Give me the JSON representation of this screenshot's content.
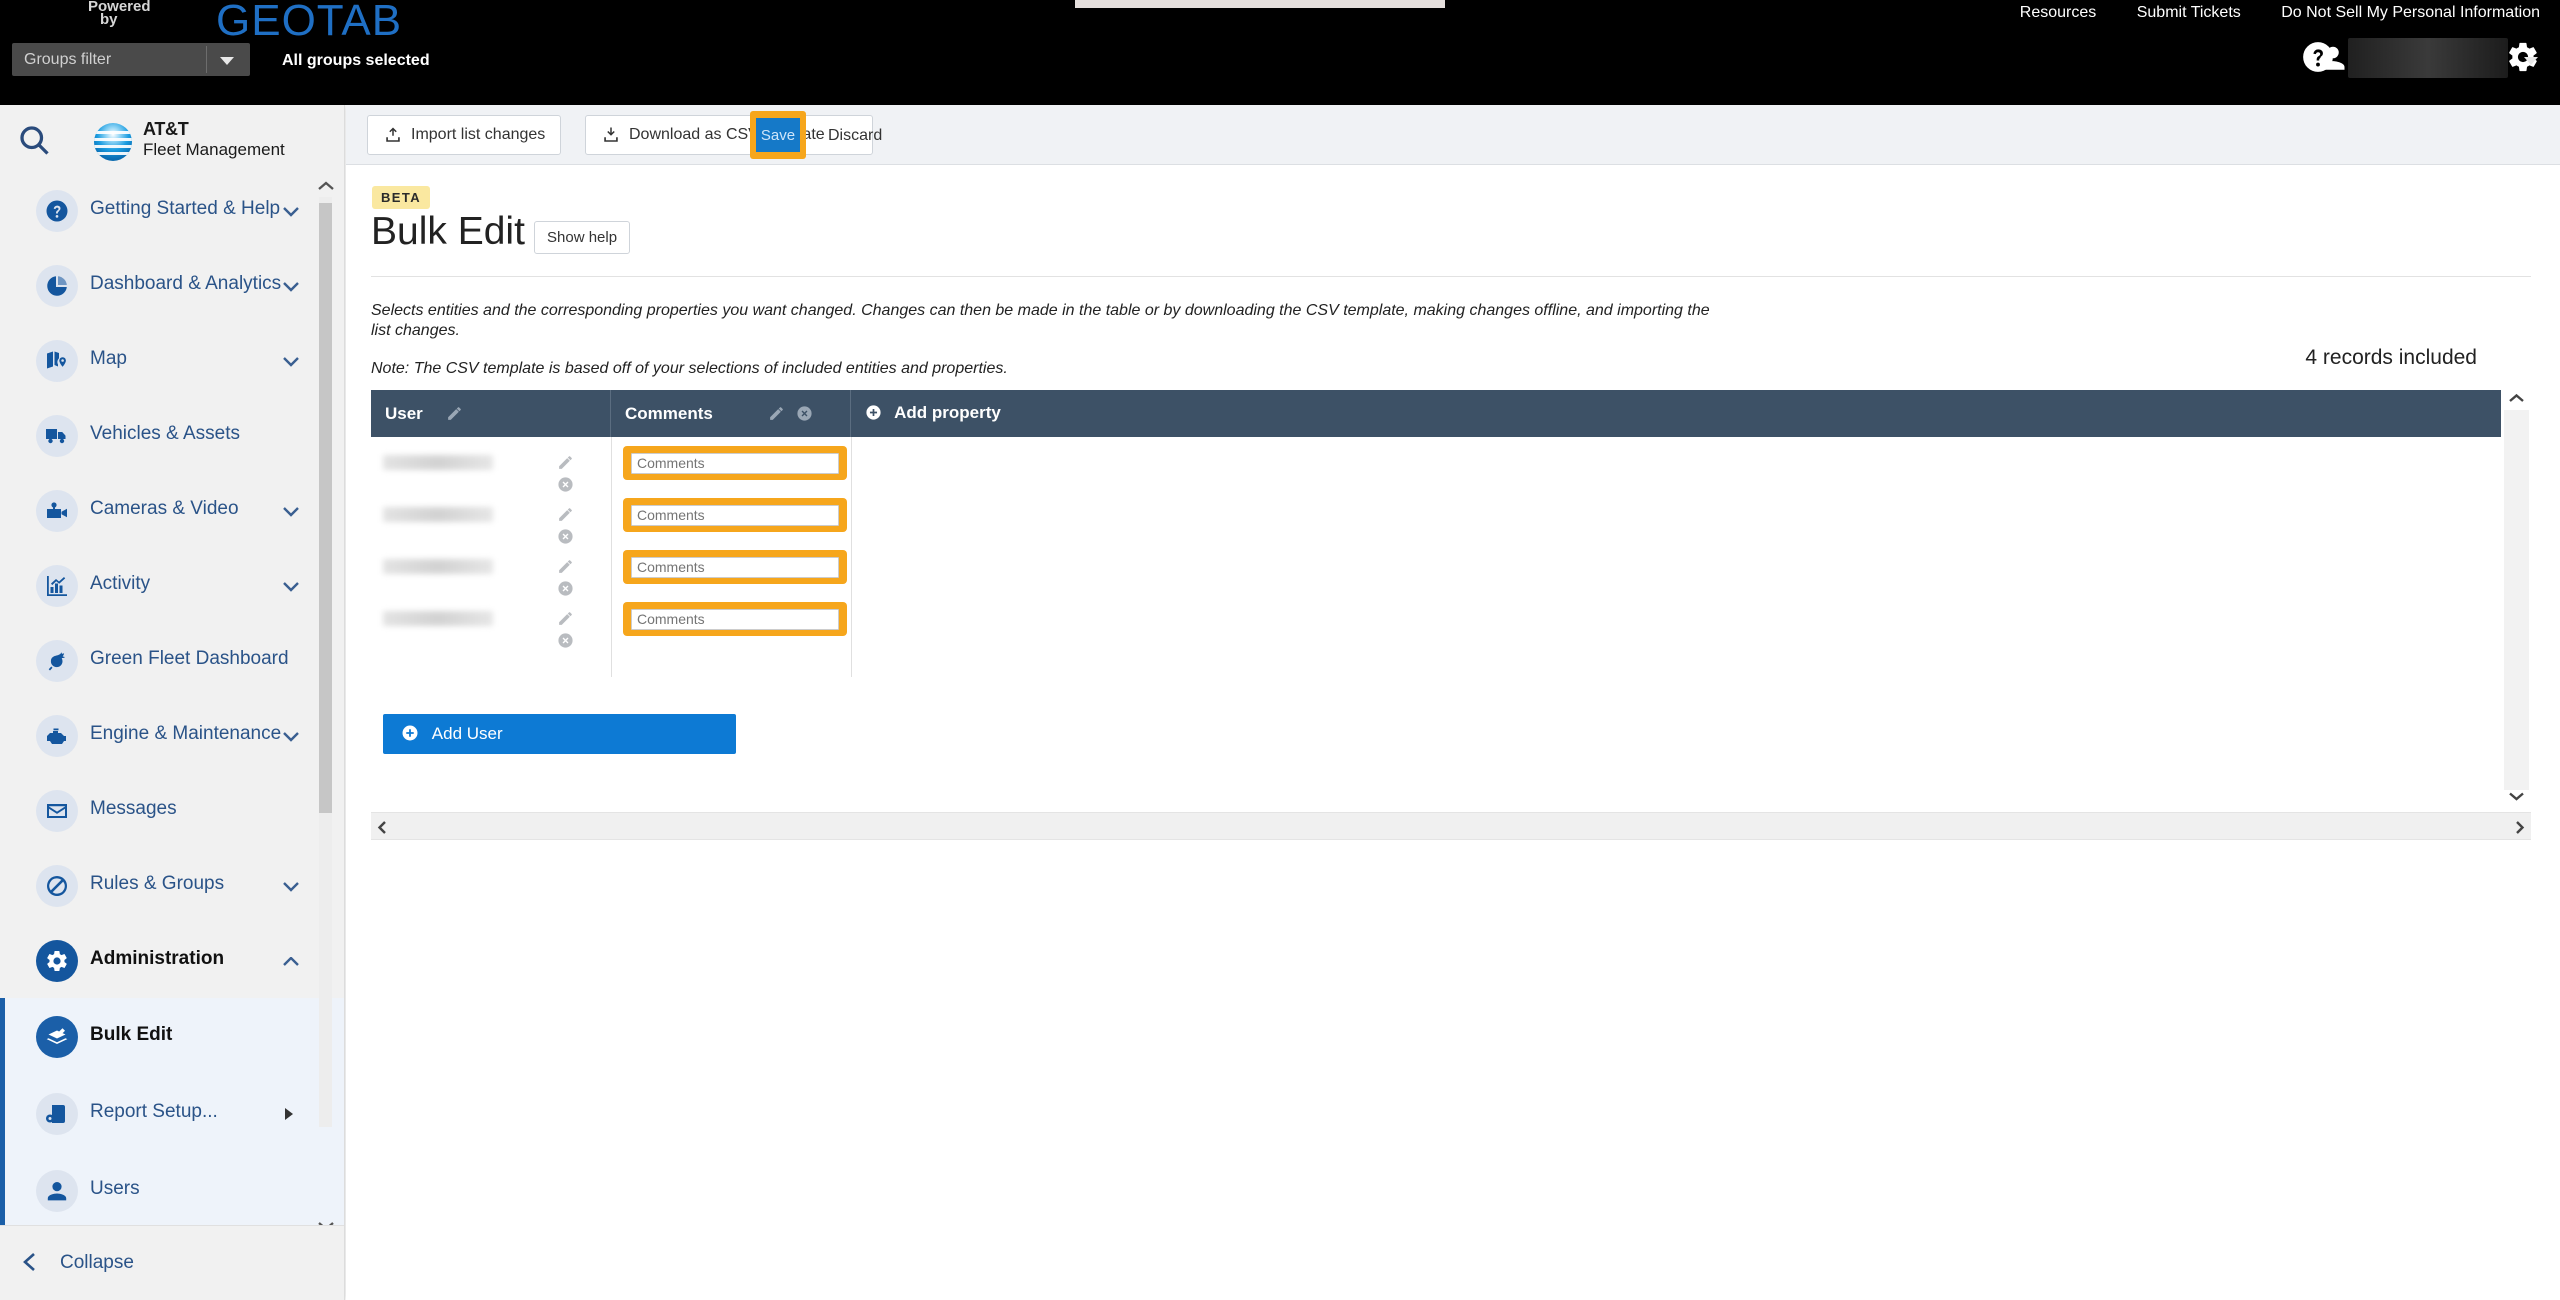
{
  "topbar": {
    "powered_line1": "Powered",
    "powered_line2": "by",
    "geotab": "GEOTAB",
    "links": [
      {
        "label": "Resources"
      },
      {
        "label": "Submit Tickets"
      },
      {
        "label": "Do Not Sell My Personal Information"
      }
    ],
    "groups_filter_placeholder": "Groups filter",
    "groups_status": "All groups selected",
    "icons": [
      "help-icon",
      "mail-icon",
      "bell-icon",
      "gear-icon",
      "user-icon"
    ],
    "user_name": ""
  },
  "sidebar": {
    "search_icon": "search-icon",
    "brand_line1": "AT&T",
    "brand_line2": "Fleet Management",
    "items": [
      {
        "label": "Getting Started & Help",
        "icon": "question-circle-icon",
        "expandable": true
      },
      {
        "label": "Dashboard & Analytics",
        "icon": "pie-chart-icon",
        "expandable": true
      },
      {
        "label": "Map",
        "icon": "map-pin-icon",
        "expandable": true
      },
      {
        "label": "Vehicles & Assets",
        "icon": "truck-icon",
        "expandable": false
      },
      {
        "label": "Cameras & Video",
        "icon": "camera-icon",
        "expandable": true
      },
      {
        "label": "Activity",
        "icon": "bar-chart-icon",
        "expandable": true
      },
      {
        "label": "Green Fleet Dashboard",
        "icon": "leaf-icon",
        "expandable": false
      },
      {
        "label": "Engine & Maintenance",
        "icon": "engine-icon",
        "expandable": true
      },
      {
        "label": "Messages",
        "icon": "envelope-icon",
        "expandable": false
      },
      {
        "label": "Rules & Groups",
        "icon": "no-entry-icon",
        "expandable": true
      },
      {
        "label": "Administration",
        "icon": "gear-icon",
        "expandable": true,
        "expanded": true
      }
    ],
    "sub_items": [
      {
        "label": "Bulk Edit",
        "icon": "bulk-edit-icon",
        "selected": true
      },
      {
        "label": "Report Setup...",
        "icon": "report-setup-icon",
        "has_submenu": true
      },
      {
        "label": "Users",
        "icon": "person-icon"
      }
    ],
    "collapse_label": "Collapse"
  },
  "toolbar": {
    "import_label": "Import list changes",
    "download_label": "Download as CSV template",
    "save_label": "Save",
    "discard_label": "Discard"
  },
  "page": {
    "beta_badge": "BETA",
    "title": "Bulk Edit",
    "show_help_label": "Show help",
    "description": "Selects entities and the corresponding properties you want changed. Changes can then be made in the table or by downloading the CSV template, making changes offline, and importing the list changes.",
    "note": "Note: The CSV template is based off of your selections of included entities and properties.",
    "records_included": "4 records included"
  },
  "table": {
    "columns": [
      {
        "label": "User",
        "icons": [
          "pencil-icon"
        ]
      },
      {
        "label": "Comments",
        "icons": [
          "pencil-icon",
          "remove-circle-icon"
        ]
      }
    ],
    "add_property_label": "Add property",
    "rows": [
      {
        "user": "",
        "comments_value": "",
        "comments_placeholder": "Comments"
      },
      {
        "user": "",
        "comments_value": "",
        "comments_placeholder": "Comments"
      },
      {
        "user": "",
        "comments_value": "",
        "comments_placeholder": "Comments"
      },
      {
        "user": "",
        "comments_value": "",
        "comments_placeholder": "Comments"
      }
    ],
    "add_user_label": "Add User"
  },
  "colors": {
    "accent_blue": "#0d7ad4",
    "highlight_orange": "#f6a61c",
    "header_slate": "#3d5166",
    "beta_yellow": "#fae8a0",
    "sidebar_bg": "#f1f1f1"
  }
}
